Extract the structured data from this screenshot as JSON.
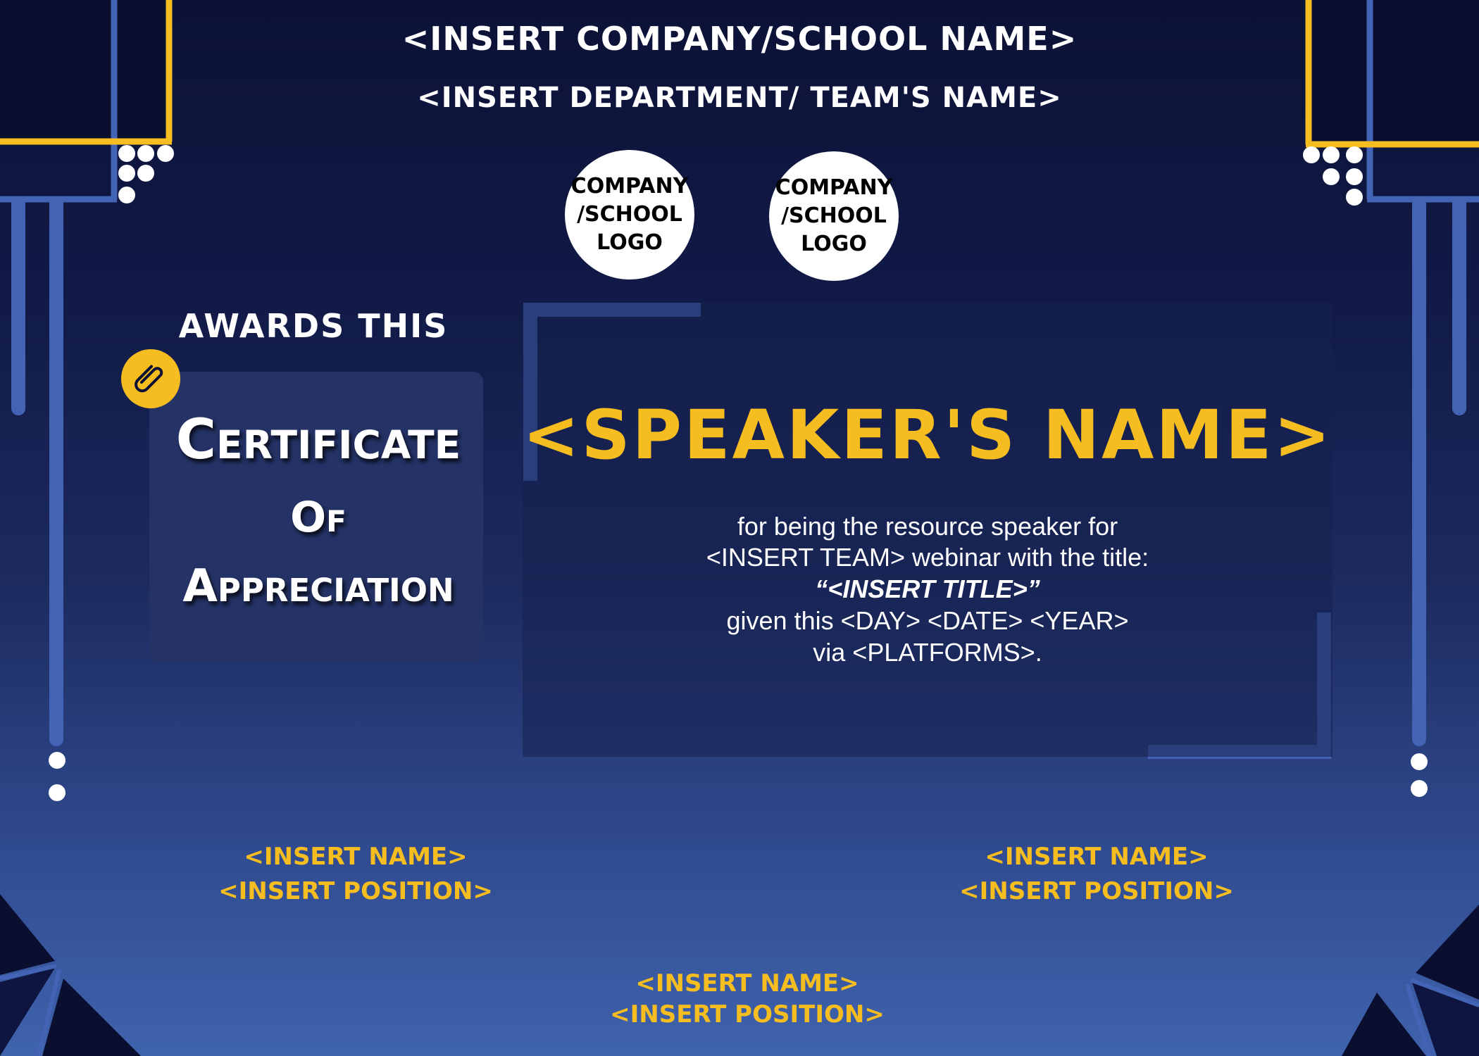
{
  "header": {
    "company": "<INSERT COMPANY/SCHOOL NAME>",
    "department": "<INSERT DEPARTMENT/ TEAM'S NAME>"
  },
  "logos": [
    {
      "label": "COMPANY\n/SCHOOL\nLOGO"
    },
    {
      "label": "COMPANY\n/SCHOOL\nLOGO"
    }
  ],
  "awards_text": "AWARDS THIS",
  "certificate": {
    "line1": "Certificate",
    "line2": "Of",
    "line3": "Appreciation"
  },
  "speaker_name": "<SPEAKER'S NAME>",
  "body": {
    "line1": "for being the resource speaker for",
    "line2": "<INSERT TEAM> webinar with the title:",
    "line3": "“<INSERT TITLE>”",
    "line4": "given this <DAY> <DATE> <YEAR>",
    "line5": "via <PLATFORMS>."
  },
  "signatories": [
    {
      "name": "<INSERT NAME>",
      "position": "<INSERT POSITION>"
    },
    {
      "name": "<INSERT NAME>",
      "position": "<INSERT POSITION>"
    },
    {
      "name": "<INSERT NAME>",
      "position": "<INSERT POSITION>"
    }
  ],
  "colors": {
    "navy": "#0c1236",
    "accent_yellow": "#f5bd1f",
    "accent_blue": "#4363b4",
    "white": "#ffffff"
  },
  "icons": {
    "paperclip": "paperclip-icon"
  }
}
